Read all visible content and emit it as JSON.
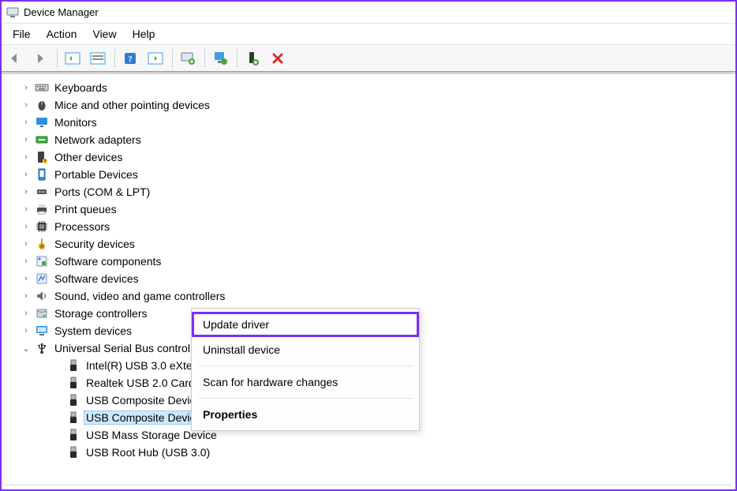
{
  "window": {
    "title": "Device Manager"
  },
  "menubar": [
    "File",
    "Action",
    "View",
    "Help"
  ],
  "toolbar": {
    "back": {
      "name": "back-icon"
    },
    "fwd": {
      "name": "forward-icon"
    },
    "show": {
      "name": "show-hidden-icon"
    },
    "props": {
      "name": "properties-icon"
    },
    "help": {
      "name": "help-icon"
    },
    "list": {
      "name": "list-view-icon"
    },
    "update": {
      "name": "update-driver-icon"
    },
    "disable": {
      "name": "disable-device-icon"
    },
    "enable": {
      "name": "enable-device-icon"
    },
    "remove": {
      "name": "uninstall-icon"
    }
  },
  "tree": [
    {
      "icon": "keyboard",
      "label": "Keyboards",
      "expanded": false
    },
    {
      "icon": "mouse",
      "label": "Mice and other pointing devices",
      "expanded": false
    },
    {
      "icon": "monitor",
      "label": "Monitors",
      "expanded": false
    },
    {
      "icon": "network",
      "label": "Network adapters",
      "expanded": false
    },
    {
      "icon": "other",
      "label": "Other devices",
      "expanded": false
    },
    {
      "icon": "portable",
      "label": "Portable Devices",
      "expanded": false
    },
    {
      "icon": "ports",
      "label": "Ports (COM & LPT)",
      "expanded": false
    },
    {
      "icon": "printer",
      "label": "Print queues",
      "expanded": false
    },
    {
      "icon": "cpu",
      "label": "Processors",
      "expanded": false
    },
    {
      "icon": "security",
      "label": "Security devices",
      "expanded": false
    },
    {
      "icon": "software",
      "label": "Software components",
      "expanded": false
    },
    {
      "icon": "software2",
      "label": "Software devices",
      "expanded": false
    },
    {
      "icon": "sound",
      "label": "Sound, video and game controllers",
      "expanded": false
    },
    {
      "icon": "storage",
      "label": "Storage controllers",
      "expanded": false
    },
    {
      "icon": "system",
      "label": "System devices",
      "expanded": false
    },
    {
      "icon": "usb",
      "label": "Universal Serial Bus controllers",
      "expanded": true,
      "children": [
        {
          "icon": "usb-dev",
          "label": "Intel(R) USB 3.0 eXten"
        },
        {
          "icon": "usb-dev",
          "label": "Realtek USB 2.0 Card"
        },
        {
          "icon": "usb-dev",
          "label": "USB Composite Device"
        },
        {
          "icon": "usb-dev",
          "label": "USB Composite Device",
          "selected": true
        },
        {
          "icon": "usb-dev",
          "label": "USB Mass Storage Device"
        },
        {
          "icon": "usb-dev",
          "label": "USB Root Hub (USB 3.0)"
        }
      ]
    }
  ],
  "context_menu": [
    {
      "key": "update",
      "label": "Update driver",
      "highlight": true
    },
    {
      "key": "uninstall",
      "label": "Uninstall device"
    },
    {
      "key": "sep"
    },
    {
      "key": "scan",
      "label": "Scan for hardware changes"
    },
    {
      "key": "sep"
    },
    {
      "key": "props",
      "label": "Properties",
      "bold": true
    }
  ]
}
